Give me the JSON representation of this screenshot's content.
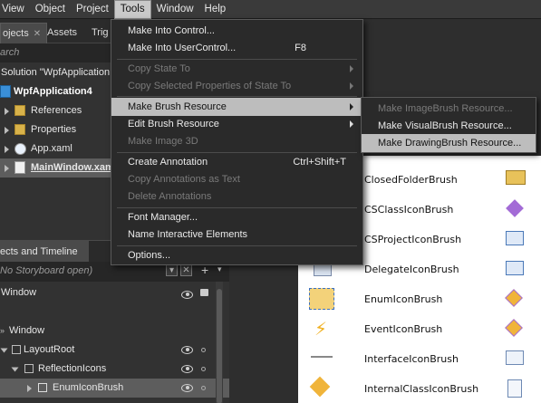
{
  "menubar": {
    "items": [
      "View",
      "Object",
      "Project",
      "Tools",
      "Window",
      "Help"
    ],
    "active": "Tools"
  },
  "projects_panel": {
    "tabs": [
      "ojects",
      "Assets",
      "Trig"
    ],
    "search_placeholder": "arch",
    "tree": [
      "Solution \"WpfApplication",
      "WpfApplication4",
      "References",
      "Properties",
      "App.xaml",
      "MainWindow.xam"
    ]
  },
  "objects_panel": {
    "title": "ects and Timeline",
    "storyboard": "No Storyboard open)",
    "tree": [
      "Window",
      "Window",
      "LayoutRoot",
      "ReflectionIcons",
      "EnumIconBrush"
    ]
  },
  "tools_menu": {
    "items": [
      {
        "label": "Make Into Control...",
        "shortcut": "",
        "enabled": true
      },
      {
        "label": "Make Into UserControl...",
        "shortcut": "F8",
        "enabled": true
      },
      {
        "label": "Copy State To",
        "shortcut": "",
        "enabled": false,
        "submenu": true
      },
      {
        "label": "Copy Selected Properties of State To",
        "shortcut": "",
        "enabled": false,
        "submenu": true
      },
      {
        "label": "Make Brush Resource",
        "shortcut": "",
        "enabled": true,
        "submenu": true,
        "highlighted": true
      },
      {
        "label": "Edit Brush Resource",
        "shortcut": "",
        "enabled": true,
        "submenu": true
      },
      {
        "label": "Make Image 3D",
        "shortcut": "",
        "enabled": false
      },
      {
        "label": "Create Annotation",
        "shortcut": "Ctrl+Shift+T",
        "enabled": true
      },
      {
        "label": "Copy Annotations as Text",
        "shortcut": "",
        "enabled": false
      },
      {
        "label": "Delete Annotations",
        "shortcut": "",
        "enabled": false
      },
      {
        "label": "Font Manager...",
        "shortcut": "",
        "enabled": true
      },
      {
        "label": "Name Interactive Elements",
        "shortcut": "",
        "enabled": true
      },
      {
        "label": "Options...",
        "shortcut": "",
        "enabled": true
      }
    ]
  },
  "brush_submenu": {
    "items": [
      {
        "label": "Make ImageBrush Resource...",
        "enabled": false
      },
      {
        "label": "Make VisualBrush Resource...",
        "enabled": true
      },
      {
        "label": "Make DrawingBrush Resource...",
        "enabled": true,
        "highlighted": true
      }
    ]
  },
  "brushes": [
    {
      "name": "ClosedFolderBrush",
      "icon": "closed-folder-icon"
    },
    {
      "name": "CSClassIconBrush",
      "icon": "cs-class-icon"
    },
    {
      "name": "CSProjectIconBrush",
      "icon": "cs-project-icon"
    },
    {
      "name": "DelegateIconBrush",
      "icon": "delegate-icon"
    },
    {
      "name": "EnumIconBrush",
      "icon": "enum-icon"
    },
    {
      "name": "EventIconBrush",
      "icon": "event-icon"
    },
    {
      "name": "InterfaceIconBrush",
      "icon": "interface-icon"
    },
    {
      "name": "InternalClassIconBrush",
      "icon": "internal-class-icon"
    }
  ]
}
